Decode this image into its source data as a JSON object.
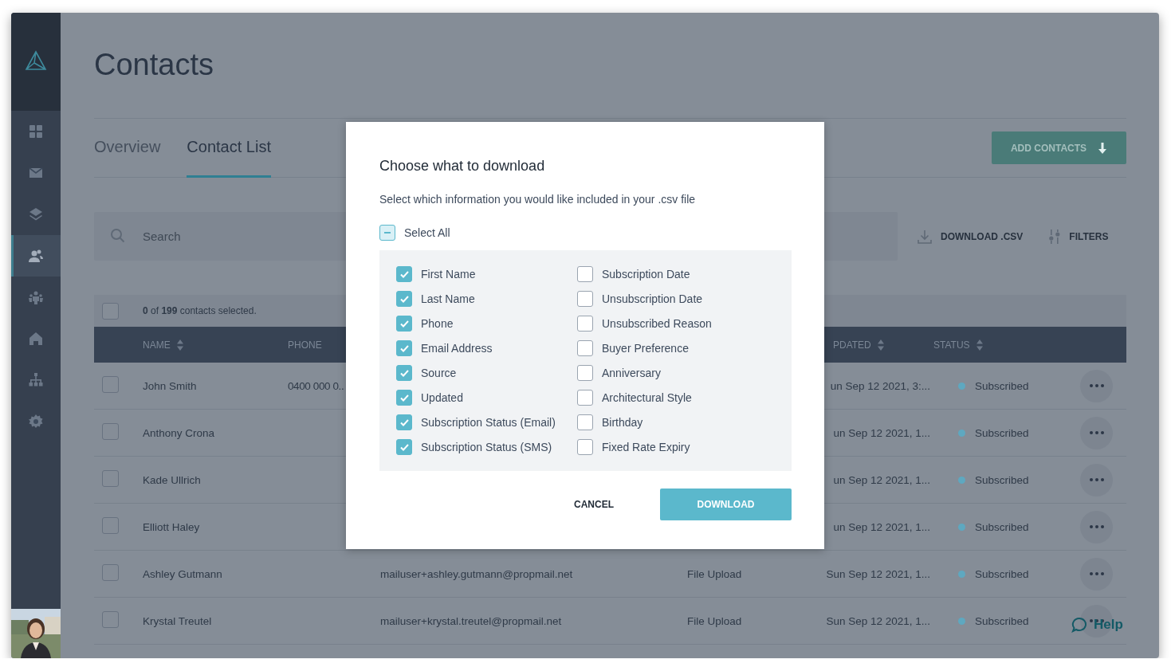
{
  "sidebar": {
    "logo": {
      "kind": "logo"
    },
    "items": [
      {
        "kind": "dashboard",
        "selected": false
      },
      {
        "kind": "mail",
        "selected": false
      },
      {
        "kind": "layers",
        "selected": false
      },
      {
        "kind": "contacts",
        "selected": true
      },
      {
        "kind": "team",
        "selected": false
      },
      {
        "kind": "home",
        "selected": false
      },
      {
        "kind": "sitemap",
        "selected": false
      },
      {
        "kind": "settings",
        "selected": false
      }
    ]
  },
  "page": {
    "title": "Contacts",
    "tabs": [
      {
        "label": "Overview",
        "selected": false
      },
      {
        "label": "Contact List",
        "selected": true
      }
    ],
    "add_button": "ADD CONTACTS",
    "search": {
      "placeholder": "Search"
    },
    "actions": [
      {
        "kind": "download",
        "label": "DOWNLOAD .CSV"
      },
      {
        "kind": "filters",
        "label": "FILTERS"
      }
    ],
    "selection": {
      "checked": false,
      "text": "**0** of **199** contacts selected."
    }
  },
  "table": {
    "columns": {
      "name": {
        "label": "NAME",
        "sortable": true
      },
      "phone": {
        "label": "PHONE",
        "sortable": false
      },
      "updated": {
        "label": "PDATED",
        "sortable": true
      },
      "status": {
        "label": "STATUS",
        "sortable": true
      }
    },
    "rows": [
      {
        "checked": false,
        "name": "John Smith",
        "phone": "0400 000 0..",
        "updated": "un Sep 12 2021, 3:...",
        "status": "Subscribed",
        "color": "#5ea8c0"
      },
      {
        "checked": false,
        "name": "Anthony Crona",
        "updated": "un Sep 12 2021, 1...",
        "status": "Subscribed",
        "color": "#5ea8c0"
      },
      {
        "checked": false,
        "name": "Kade Ullrich",
        "updated": "un Sep 12 2021, 1...",
        "status": "Subscribed",
        "color": "#5ea8c0"
      },
      {
        "checked": false,
        "name": "Elliott Haley",
        "updated": "un Sep 12 2021, 1...",
        "status": "Subscribed",
        "color": "#5ea8c0"
      },
      {
        "checked": false,
        "name": "Ashley Gutmann",
        "email": "mailuser+ashley.gutmann@propmail.net",
        "source": "File Upload",
        "updated": "Sun Sep 12 2021, 1...",
        "status": "Subscribed",
        "color": "#5ea8c0"
      },
      {
        "checked": false,
        "name": "Krystal Treutel",
        "email": "mailuser+krystal.treutel@propmail.net",
        "source": "File Upload",
        "updated": "Sun Sep 12 2021, 1...",
        "status": "Subscribed",
        "color": "#5ea8c0"
      }
    ]
  },
  "help": {
    "label": "Help"
  },
  "dialog": {
    "title": "Choose what to download",
    "subtitle": "Select which information you would like included in your .csv file",
    "select_all": {
      "label": "Select All",
      "indeterminate": true
    },
    "columns": [
      [
        {
          "label": "First Name",
          "checked": true
        },
        {
          "label": "Last Name",
          "checked": true
        },
        {
          "label": "Phone",
          "checked": true
        },
        {
          "label": "Email Address",
          "checked": true
        },
        {
          "label": "Source",
          "checked": true
        },
        {
          "label": "Updated",
          "checked": true
        },
        {
          "label": "Subscription Status (Email)",
          "checked": true
        },
        {
          "label": "Subscription Status (SMS)",
          "checked": true
        }
      ],
      [
        {
          "label": "Subscription Date",
          "checked": false
        },
        {
          "label": "Unsubscription Date",
          "checked": false
        },
        {
          "label": "Unsubscribed Reason",
          "checked": false
        },
        {
          "label": "Buyer Preference",
          "checked": false
        },
        {
          "label": "Anniversary",
          "checked": false
        },
        {
          "label": "Architectural Style",
          "checked": false
        },
        {
          "label": "Birthday",
          "checked": false
        },
        {
          "label": "Fixed Rate Expiry",
          "checked": false
        }
      ]
    ],
    "buttons": [
      {
        "kind": "secondary",
        "label": "CANCEL"
      },
      {
        "kind": "primary",
        "label": "DOWNLOAD"
      }
    ]
  }
}
